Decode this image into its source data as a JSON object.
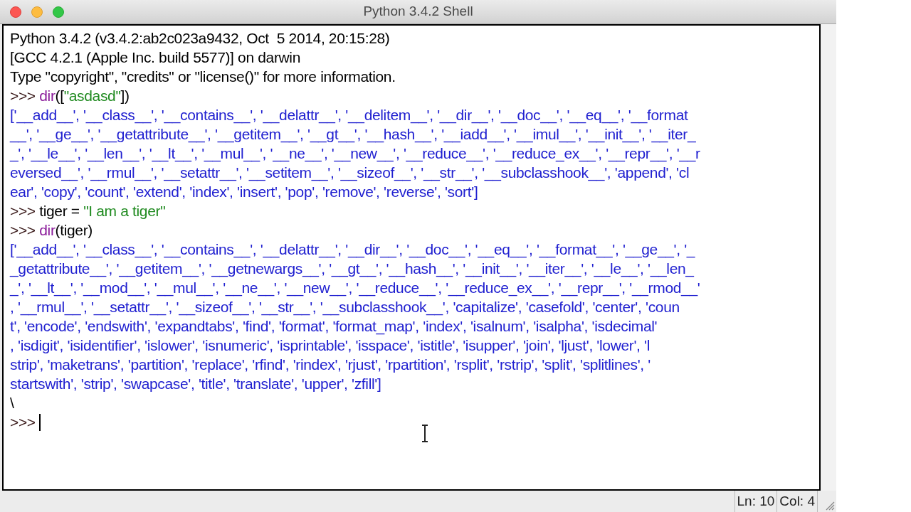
{
  "window": {
    "title": "Python 3.4.2 Shell"
  },
  "lines": [
    [
      {
        "kind": "stdout",
        "text": "Python 3.4.2 (v3.4.2:ab2c023a9432, Oct  5 2014, 20:15:28)"
      }
    ],
    [
      {
        "kind": "stdout",
        "text": "[GCC 4.2.1 (Apple Inc. build 5577)] on darwin"
      }
    ],
    [
      {
        "kind": "stdout",
        "text": "Type \"copyright\", \"credits\" or \"license()\" for more information."
      }
    ],
    [
      {
        "kind": "prompt",
        "text": ">>> "
      },
      {
        "kind": "builtin",
        "text": "dir"
      },
      {
        "kind": "code",
        "text": "(["
      },
      {
        "kind": "string",
        "text": "\"asdasd\""
      },
      {
        "kind": "code",
        "text": "])"
      }
    ],
    [
      {
        "kind": "output",
        "text": "['__add__', '__class__', '__contains__', '__delattr__', '__delitem__', '__dir__', '__doc__', '__eq__', '__format"
      }
    ],
    [
      {
        "kind": "output",
        "text": "__', '__ge__', '__getattribute__', '__getitem__', '__gt__', '__hash__', '__iadd__', '__imul__', '__init__', '__iter_"
      }
    ],
    [
      {
        "kind": "output",
        "text": "_', '__le__', '__len__', '__lt__', '__mul__', '__ne__', '__new__', '__reduce__', '__reduce_ex__', '__repr__', '__r"
      }
    ],
    [
      {
        "kind": "output",
        "text": "eversed__', '__rmul__', '__setattr__', '__setitem__', '__sizeof__', '__str__', '__subclasshook__', 'append', 'cl"
      }
    ],
    [
      {
        "kind": "output",
        "text": "ear', 'copy', 'count', 'extend', 'index', 'insert', 'pop', 'remove', 'reverse', 'sort']"
      }
    ],
    [
      {
        "kind": "prompt",
        "text": ">>> "
      },
      {
        "kind": "code",
        "text": "tiger = "
      },
      {
        "kind": "string",
        "text": "\"I am a tiger\""
      }
    ],
    [
      {
        "kind": "prompt",
        "text": ">>> "
      },
      {
        "kind": "builtin",
        "text": "dir"
      },
      {
        "kind": "code",
        "text": "(tiger)"
      }
    ],
    [
      {
        "kind": "output",
        "text": "['__add__', '__class__', '__contains__', '__delattr__', '__dir__', '__doc__', '__eq__', '__format__', '__ge__', '_"
      }
    ],
    [
      {
        "kind": "output",
        "text": "_getattribute__', '__getitem__', '__getnewargs__', '__gt__', '__hash__', '__init__', '__iter__', '__le__', '__len_"
      }
    ],
    [
      {
        "kind": "output",
        "text": "_', '__lt__', '__mod__', '__mul__', '__ne__', '__new__', '__reduce__', '__reduce_ex__', '__repr__', '__rmod__'"
      }
    ],
    [
      {
        "kind": "output",
        "text": ", '__rmul__', '__setattr__', '__sizeof__', '__str__', '__subclasshook__', 'capitalize', 'casefold', 'center', 'coun"
      }
    ],
    [
      {
        "kind": "output",
        "text": "t', 'encode', 'endswith', 'expandtabs', 'find', 'format', 'format_map', 'index', 'isalnum', 'isalpha', 'isdecimal'"
      }
    ],
    [
      {
        "kind": "output",
        "text": ", 'isdigit', 'isidentifier', 'islower', 'isnumeric', 'isprintable', 'isspace', 'istitle', 'isupper', 'join', 'ljust', 'lower', 'l"
      }
    ],
    [
      {
        "kind": "output",
        "text": "strip', 'maketrans', 'partition', 'replace', 'rfind', 'rindex', 'rjust', 'rpartition', 'rsplit', 'rstrip', 'split', 'splitlines', '"
      }
    ],
    [
      {
        "kind": "output",
        "text": "startswith', 'strip', 'swapcase', 'title', 'translate', 'upper', 'zfill']"
      }
    ],
    [
      {
        "kind": "code",
        "text": "\\"
      }
    ],
    [
      {
        "kind": "prompt",
        "text": ">>> "
      }
    ]
  ],
  "status_bar": {
    "line": "Ln: 10",
    "column": "Col: 4"
  }
}
